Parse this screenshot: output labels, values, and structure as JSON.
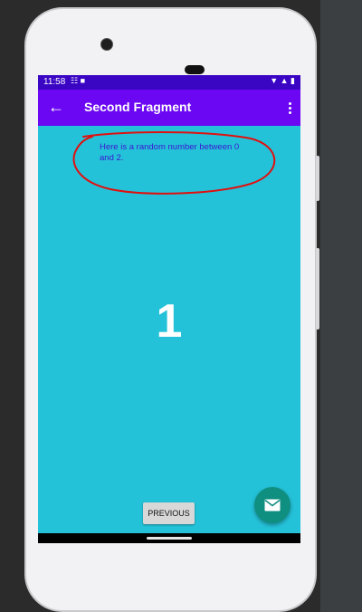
{
  "status_bar": {
    "time": "11:58",
    "left_icons": "☷ ■",
    "right_icons": "▼ ▲ ▮"
  },
  "app_bar": {
    "title": "Second Fragment",
    "back_icon": "←"
  },
  "content": {
    "info_text": "Here is a random number between 0 and 2.",
    "random_number": "1"
  },
  "buttons": {
    "previous_label": "PREVIOUS"
  },
  "colors": {
    "status_bar": "#3a06c4",
    "app_bar": "#6b07f3",
    "background": "#24c2d8",
    "fab": "#0f8f80",
    "annotation": "#e01010"
  }
}
